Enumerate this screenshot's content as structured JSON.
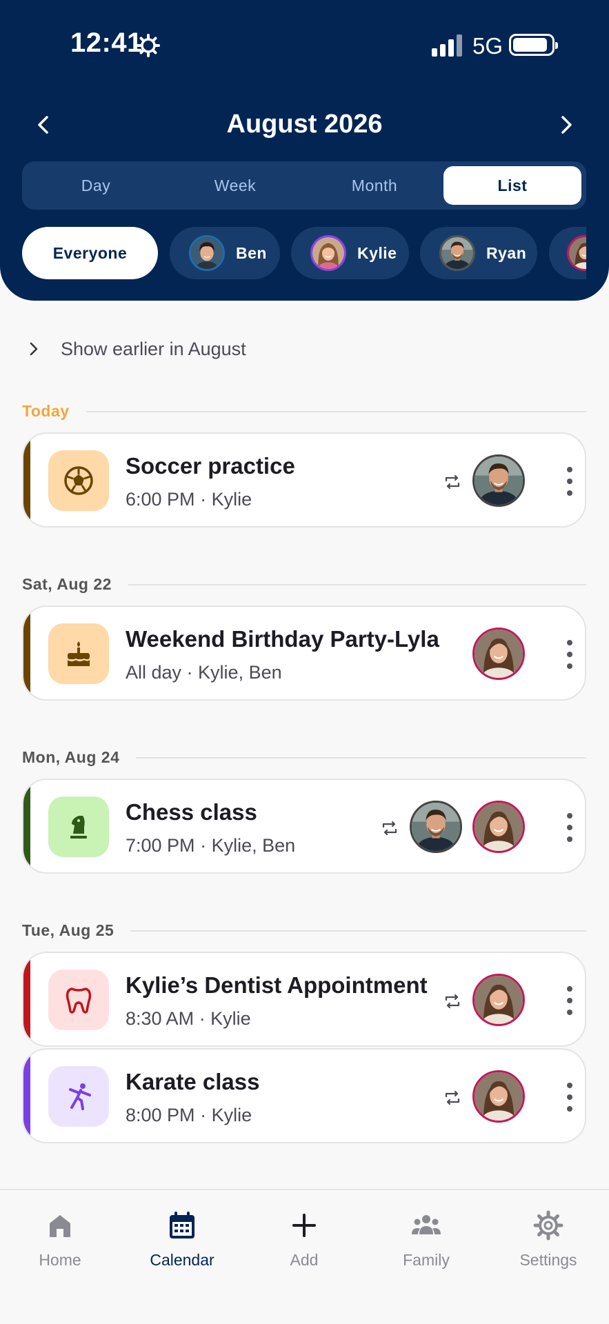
{
  "status": {
    "time": "12:41",
    "network": "5G"
  },
  "header": {
    "title": "August 2026"
  },
  "view_tabs": [
    "Day",
    "Week",
    "Month",
    "List"
  ],
  "active_view": "List",
  "people": [
    {
      "name": "Everyone",
      "active": true
    },
    {
      "name": "Ben",
      "ring": "#1E6FA8"
    },
    {
      "name": "Kylie",
      "ring": "#8B42E8"
    },
    {
      "name": "Ryan",
      "ring": "#555555"
    }
  ],
  "show_earlier": "Show earlier in August",
  "groups": [
    {
      "label": "Today",
      "events": [
        {
          "title": "Soccer practice",
          "time": "6:00 PM",
          "attendees": "Kylie",
          "icon": "soccer-ball-icon",
          "accent": "#6B4400",
          "icon_bg": "#FFD9A8",
          "recurring": true
        }
      ]
    },
    {
      "label": "Sat, Aug 22",
      "events": [
        {
          "title": "Weekend Birthday Party-Lyla",
          "time": "All day",
          "attendees": "Kylie, Ben",
          "icon": "birthday-cake-icon",
          "accent": "#6B4400",
          "icon_bg": "#FFD9A8",
          "recurring": false
        }
      ]
    },
    {
      "label": "Mon, Aug 24",
      "events": [
        {
          "title": "Chess class",
          "time": "7:00 PM",
          "attendees": "Kylie, Ben",
          "icon": "chess-knight-icon",
          "accent": "#2E5B17",
          "icon_bg": "#C9F2B5",
          "recurring": true
        }
      ]
    },
    {
      "label": "Tue, Aug 25",
      "events": [
        {
          "title": "Kylie’s Dentist Appointment",
          "time": "8:30 AM",
          "attendees": "Kylie",
          "icon": "tooth-icon",
          "accent": "#C0161D",
          "icon_bg": "#FFE0E0",
          "recurring": true
        },
        {
          "title": "Karate class",
          "time": "8:00 PM",
          "attendees": "Kylie",
          "icon": "karate-kick-icon",
          "accent": "#7B3FE4",
          "icon_bg": "#ECE4FF",
          "recurring": true
        }
      ]
    }
  ],
  "tabbar": [
    {
      "label": "Home",
      "icon": "home-icon"
    },
    {
      "label": "Calendar",
      "icon": "calendar-icon",
      "active": true
    },
    {
      "label": "Add",
      "icon": "plus-icon"
    },
    {
      "label": "Family",
      "icon": "family-icon"
    },
    {
      "label": "Settings",
      "icon": "settings-gear-icon"
    }
  ],
  "colors": {
    "header": "#032553",
    "today": "#F5A637",
    "background": "#F8F8F8"
  }
}
